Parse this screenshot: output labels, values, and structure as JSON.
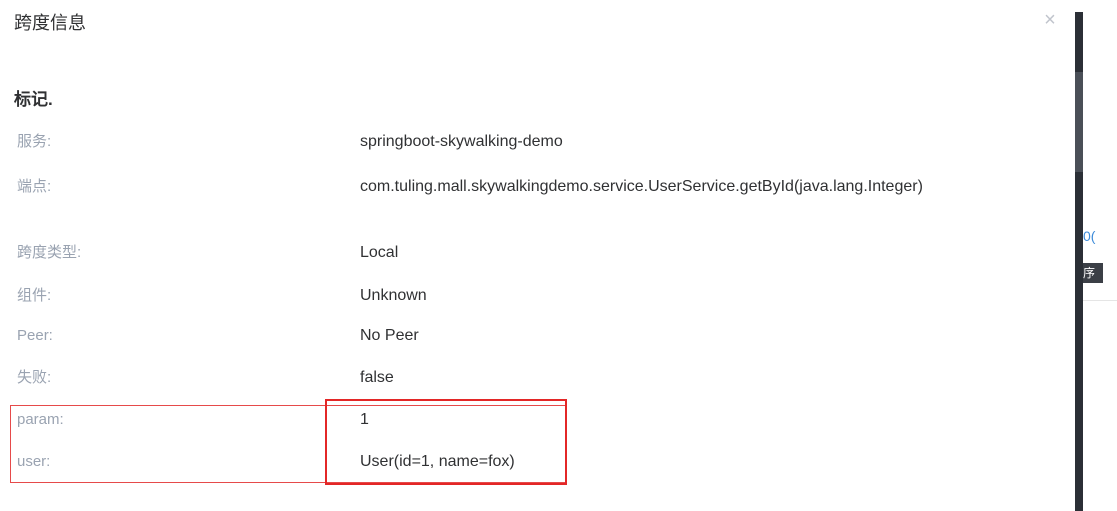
{
  "dialog": {
    "title": "跨度信息",
    "close_glyph": "×",
    "section_title": "标记."
  },
  "rows": [
    {
      "label": "服务:",
      "value": "springboot-skywalking-demo"
    },
    {
      "label": "端点:",
      "value": "com.tuling.mall.skywalkingdemo.service.UserService.getById(java.lang.Integer)"
    },
    {
      "label": "跨度类型:",
      "value": "Local"
    },
    {
      "label": "组件:",
      "value": "Unknown"
    },
    {
      "label": "Peer:",
      "value": "No Peer"
    },
    {
      "label": "失败:",
      "value": "false"
    },
    {
      "label": "param:",
      "value": "1"
    },
    {
      "label": "user:",
      "value": "User(id=1, name=fox)"
    }
  ],
  "background": {
    "link_fragment": "0(",
    "dark_label_fragment": "序"
  },
  "colors": {
    "highlight": "#e32727",
    "label": "#9aa3b1",
    "value": "#303133"
  }
}
